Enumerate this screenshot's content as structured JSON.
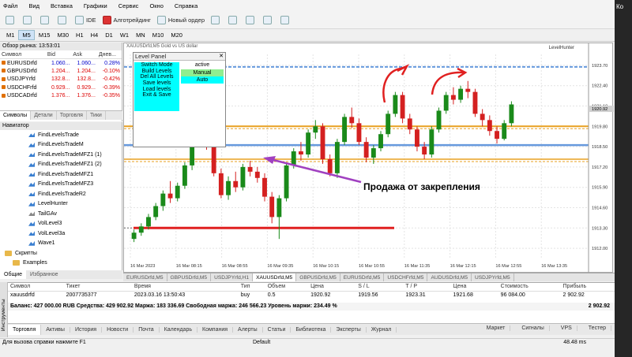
{
  "window": {
    "corner_text": "Ко"
  },
  "menu": [
    "Файл",
    "Вид",
    "Вставка",
    "Графики",
    "Сервис",
    "Окно",
    "Справка"
  ],
  "toolbar": {
    "ide": "IDE",
    "algo": "Алготрейдинг",
    "new_order": "Новый ордер"
  },
  "timeframes": [
    "M1",
    "M5",
    "M15",
    "M30",
    "H1",
    "H4",
    "D1",
    "W1",
    "MN",
    "M10",
    "M20"
  ],
  "timeframe_selected": "M5",
  "market_watch": {
    "title": "Обзор рынка: 13:53:01",
    "headers": [
      "Символ",
      "Bid",
      "Ask",
      "Днев..."
    ],
    "rows": [
      {
        "sym": "EURUSDrfd",
        "bid": "1.060...",
        "ask": "1.060...",
        "chg": "0.28%"
      },
      {
        "sym": "GBPUSDrfd",
        "bid": "1.204...",
        "ask": "1.204...",
        "chg": "-0.10%"
      },
      {
        "sym": "USDJPYrfd",
        "bid": "132.8...",
        "ask": "132.8...",
        "chg": "-0.42%"
      },
      {
        "sym": "USDCHFrfd",
        "bid": "0.929...",
        "ask": "0.929...",
        "chg": "-0.39%"
      },
      {
        "sym": "USDCADrfd",
        "bid": "1.376...",
        "ask": "1.376...",
        "chg": "-0.35%"
      }
    ],
    "tabs": [
      "Символы",
      "Детали",
      "Торговля",
      "Тики"
    ]
  },
  "navigator": {
    "title": "Навигатор",
    "items": [
      "FindLevelsTrade",
      "FindLevelsTradeM",
      "FindLevelsTradeMFZ1 (1)",
      "FindLevelsTradeMFZ1 (2)",
      "FindLevelsTradeMFZ1",
      "FindLevelsTradeMFZ3",
      "FindLevelsTradeR2",
      "LevelHunter",
      "TailGAv",
      "VolLevel3",
      "VolLevel3a",
      "Wave1"
    ],
    "folders": [
      "Скрипты",
      "Examples"
    ],
    "tabs": [
      "Общие",
      "Избранное"
    ]
  },
  "chart": {
    "title": "XAUUSDrfd,M5  Gold vs US dollar",
    "indicator": "LevelHunter",
    "price_labels": [
      "1923.70",
      "1922.40",
      "1921.10",
      "1919.80",
      "1918.50",
      "1917.20",
      "1915.90",
      "1914.60",
      "1913.30",
      "1912.00"
    ],
    "current_price": "1920.92",
    "time_labels": [
      "16 Mar 2023",
      "16 Mar 08:15",
      "16 Mar 08:55",
      "16 Mar 09:35",
      "16 Mar 10:15",
      "16 Mar 10:55",
      "16 Mar 11:35",
      "16 Mar 12:15",
      "16 Mar 12:55",
      "16 Mar 13:35"
    ],
    "annotation": "Продажа от закрепления",
    "colors": {
      "bull": "#1a8a1a",
      "bear": "#d42020",
      "support": "#e02020",
      "level_blue": "#6699dd",
      "level_orange": "#e8a020",
      "arrow": "#a040c0"
    },
    "candles": [
      [
        1912.6,
        1913.2,
        1912.4,
        1913.0
      ],
      [
        1913.0,
        1913.6,
        1912.8,
        1913.4
      ],
      [
        1913.4,
        1914.2,
        1913.2,
        1914.0
      ],
      [
        1914.0,
        1914.9,
        1913.8,
        1914.7
      ],
      [
        1914.7,
        1915.7,
        1914.4,
        1915.5
      ],
      [
        1915.5,
        1916.3,
        1914.9,
        1915.2
      ],
      [
        1915.2,
        1916.2,
        1915.0,
        1916.0
      ],
      [
        1916.0,
        1917.5,
        1915.8,
        1917.3
      ],
      [
        1917.3,
        1919.5,
        1917.0,
        1919.2
      ],
      [
        1919.2,
        1919.9,
        1918.6,
        1919.0
      ],
      [
        1919.0,
        1920.2,
        1918.3,
        1918.5
      ],
      [
        1918.5,
        1918.8,
        1916.6,
        1916.8
      ],
      [
        1916.8,
        1917.1,
        1915.2,
        1915.4
      ],
      [
        1915.4,
        1916.6,
        1915.1,
        1916.3
      ],
      [
        1916.3,
        1916.9,
        1915.6,
        1915.9
      ],
      [
        1915.9,
        1917.4,
        1915.7,
        1917.2
      ],
      [
        1917.2,
        1917.6,
        1916.6,
        1916.9
      ],
      [
        1916.9,
        1917.2,
        1916.2,
        1916.5
      ],
      [
        1916.5,
        1916.8,
        1915.0,
        1915.3
      ],
      [
        1915.3,
        1915.6,
        1913.6,
        1914.0
      ],
      [
        1914.0,
        1915.4,
        1912.6,
        1915.2
      ],
      [
        1915.2,
        1917.5,
        1915.0,
        1917.3
      ],
      [
        1917.3,
        1918.4,
        1917.1,
        1918.2
      ],
      [
        1918.2,
        1918.8,
        1917.6,
        1918.0
      ],
      [
        1918.0,
        1919.6,
        1917.8,
        1919.4
      ],
      [
        1919.4,
        1920.2,
        1919.0,
        1919.8
      ],
      [
        1919.8,
        1920.0,
        1917.4,
        1917.7
      ],
      [
        1917.7,
        1918.0,
        1916.6,
        1916.8
      ],
      [
        1916.8,
        1919.0,
        1916.5,
        1918.8
      ],
      [
        1918.8,
        1920.6,
        1918.6,
        1920.4
      ],
      [
        1920.4,
        1921.0,
        1919.7,
        1920.0
      ],
      [
        1920.0,
        1920.3,
        1918.6,
        1918.8
      ],
      [
        1918.8,
        1919.1,
        1917.5,
        1917.8
      ],
      [
        1917.8,
        1918.6,
        1917.4,
        1918.4
      ],
      [
        1918.4,
        1919.5,
        1918.2,
        1919.3
      ],
      [
        1919.3,
        1920.8,
        1919.1,
        1920.6
      ],
      [
        1920.6,
        1922.0,
        1920.4,
        1921.8
      ],
      [
        1921.8,
        1922.0,
        1920.0,
        1920.3
      ],
      [
        1920.3,
        1920.6,
        1919.3,
        1919.6
      ],
      [
        1919.6,
        1919.8,
        1918.2,
        1918.5
      ],
      [
        1918.5,
        1918.8,
        1917.7,
        1918.0
      ],
      [
        1918.0,
        1919.8,
        1917.8,
        1919.6
      ],
      [
        1919.6,
        1921.0,
        1919.4,
        1920.8
      ],
      [
        1920.8,
        1922.0,
        1920.6,
        1921.8
      ],
      [
        1921.8,
        1922.3,
        1921.2,
        1921.5
      ],
      [
        1921.5,
        1922.4,
        1921.3,
        1922.2
      ],
      [
        1922.2,
        1922.7,
        1921.6,
        1922.0
      ],
      [
        1922.0,
        1922.2,
        1920.4,
        1920.6
      ],
      [
        1920.6,
        1920.9,
        1919.8,
        1920.2
      ],
      [
        1920.2,
        1920.5,
        1919.2,
        1919.5
      ],
      [
        1919.5,
        1919.8,
        1918.7,
        1919.0
      ],
      [
        1919.0,
        1920.2,
        1918.9,
        1920.0
      ],
      [
        1920.0,
        1921.4,
        1919.8,
        1921.2
      ]
    ],
    "levels": {
      "blue_top": 1923.6,
      "orange_mid": 1919.8,
      "blue_mid": 1918.6,
      "orange_low": 1917.7,
      "red_support": 1913.3
    }
  },
  "level_panel": {
    "title": "Level Panel",
    "buttons": [
      "Switch Mode",
      "Build Levels",
      "Del All Levels",
      "Save levels",
      "Load levels",
      "Exit & Save"
    ],
    "status": "active",
    "mode_manual": "Manual",
    "mode_auto": "Auto"
  },
  "chart_tabs": [
    "EURUSDrfd,M5",
    "GBPUSDrfd,M5",
    "USDJPYrfd,H1",
    "XAUUSDrfd,M5",
    "GBPUSDrfd,M5",
    "EURUSDrfd,M5",
    "USDCHFrfd,M5",
    "AUDUSDrfd,M5",
    "USDJPYrfd,M5"
  ],
  "chart_tab_selected": "XAUUSDrfd,M5",
  "terminal": {
    "headers": [
      "Символ",
      "Тикет",
      "Время",
      "Тип",
      "Объем",
      "Цена",
      "S / L",
      "T / P",
      "Цена",
      "Стоимость",
      "Прибыль"
    ],
    "row": [
      "xauusdrfd",
      "2007735377",
      "2023.03.16 13:50:43",
      "buy",
      "0.5",
      "1920.92",
      "1919.56",
      "1923.31",
      "1921.68",
      "96 084.00",
      "2 902.92"
    ],
    "balance": "Баланс: 427 000.00 RUB  Средства: 429 902.92  Маржа: 183 336.69  Свободная маржа: 246 566.23  Уровень маржи: 234.49 %",
    "balance_profit": "2 902.92",
    "tabs": [
      "Торговля",
      "Активы",
      "История",
      "Новости",
      "Почта",
      "Календарь",
      "Компания",
      "Алерты",
      "Статьи",
      "Библиотека",
      "Эксперты",
      "Журнал"
    ],
    "right": [
      "Маркет",
      "Сигналы",
      "VPS",
      "Тестер"
    ],
    "side_label": "Инструменты"
  },
  "status": {
    "help": "Для вызова справки нажмите F1",
    "profile": "Default",
    "ping": "48.48 ms"
  }
}
